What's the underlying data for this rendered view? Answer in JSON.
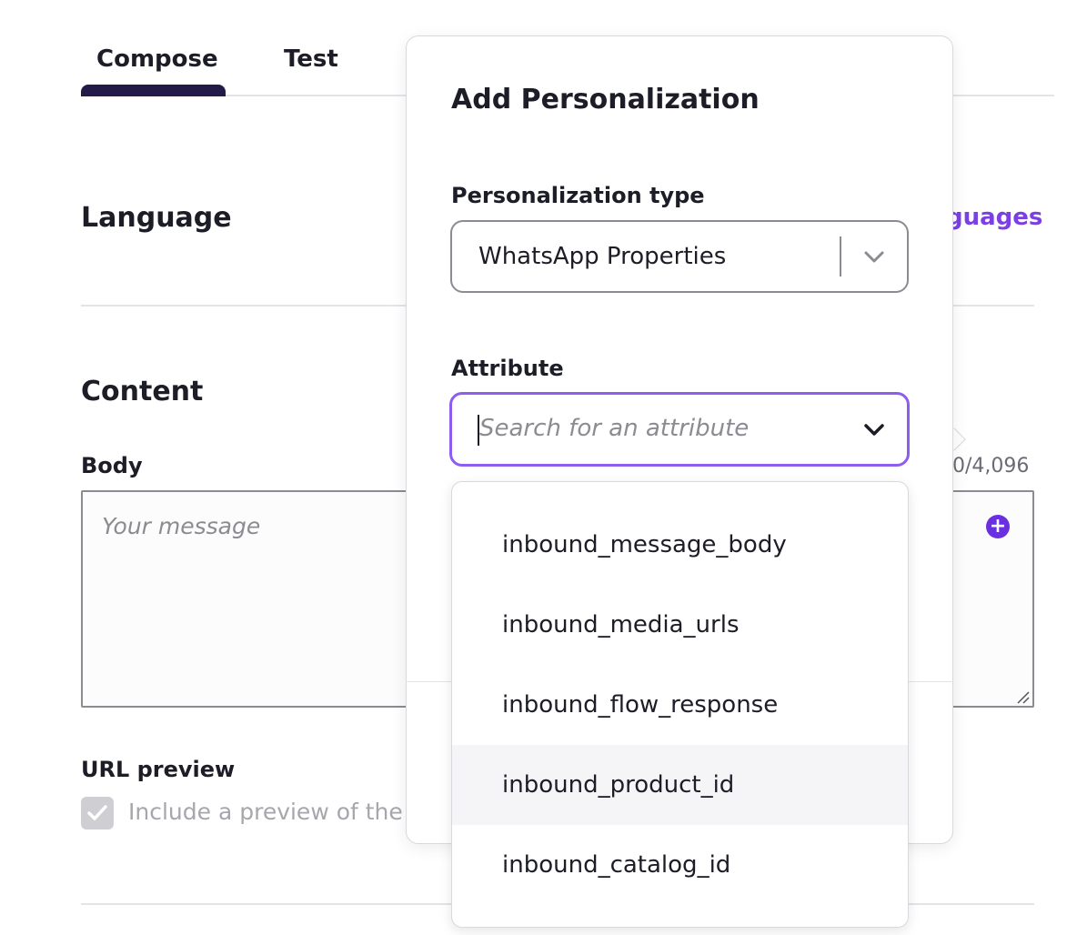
{
  "tabs": [
    {
      "label": "Compose",
      "active": true
    },
    {
      "label": "Test",
      "active": false
    }
  ],
  "language": {
    "title": "Language",
    "link_label": "guages"
  },
  "content": {
    "title": "Content",
    "body_label": "Body",
    "body_placeholder": "Your message",
    "char_count": "0/4,096",
    "url_preview_label": "URL preview",
    "url_preview_checkbox_text": "Include a preview of the U",
    "url_preview_checked": true
  },
  "popover": {
    "title": "Add Personalization",
    "type_label": "Personalization type",
    "type_value": "WhatsApp Properties",
    "attribute_label": "Attribute",
    "attribute_placeholder": "Search for an attribute",
    "options": [
      "inbound_message_body",
      "inbound_media_urls",
      "inbound_flow_response",
      "inbound_product_id",
      "inbound_catalog_id"
    ],
    "hovered_option_index": 3
  },
  "colors": {
    "accent": "#7b3fe4",
    "tab_indicator": "#231a47",
    "focus_border": "#8f5cf0"
  }
}
